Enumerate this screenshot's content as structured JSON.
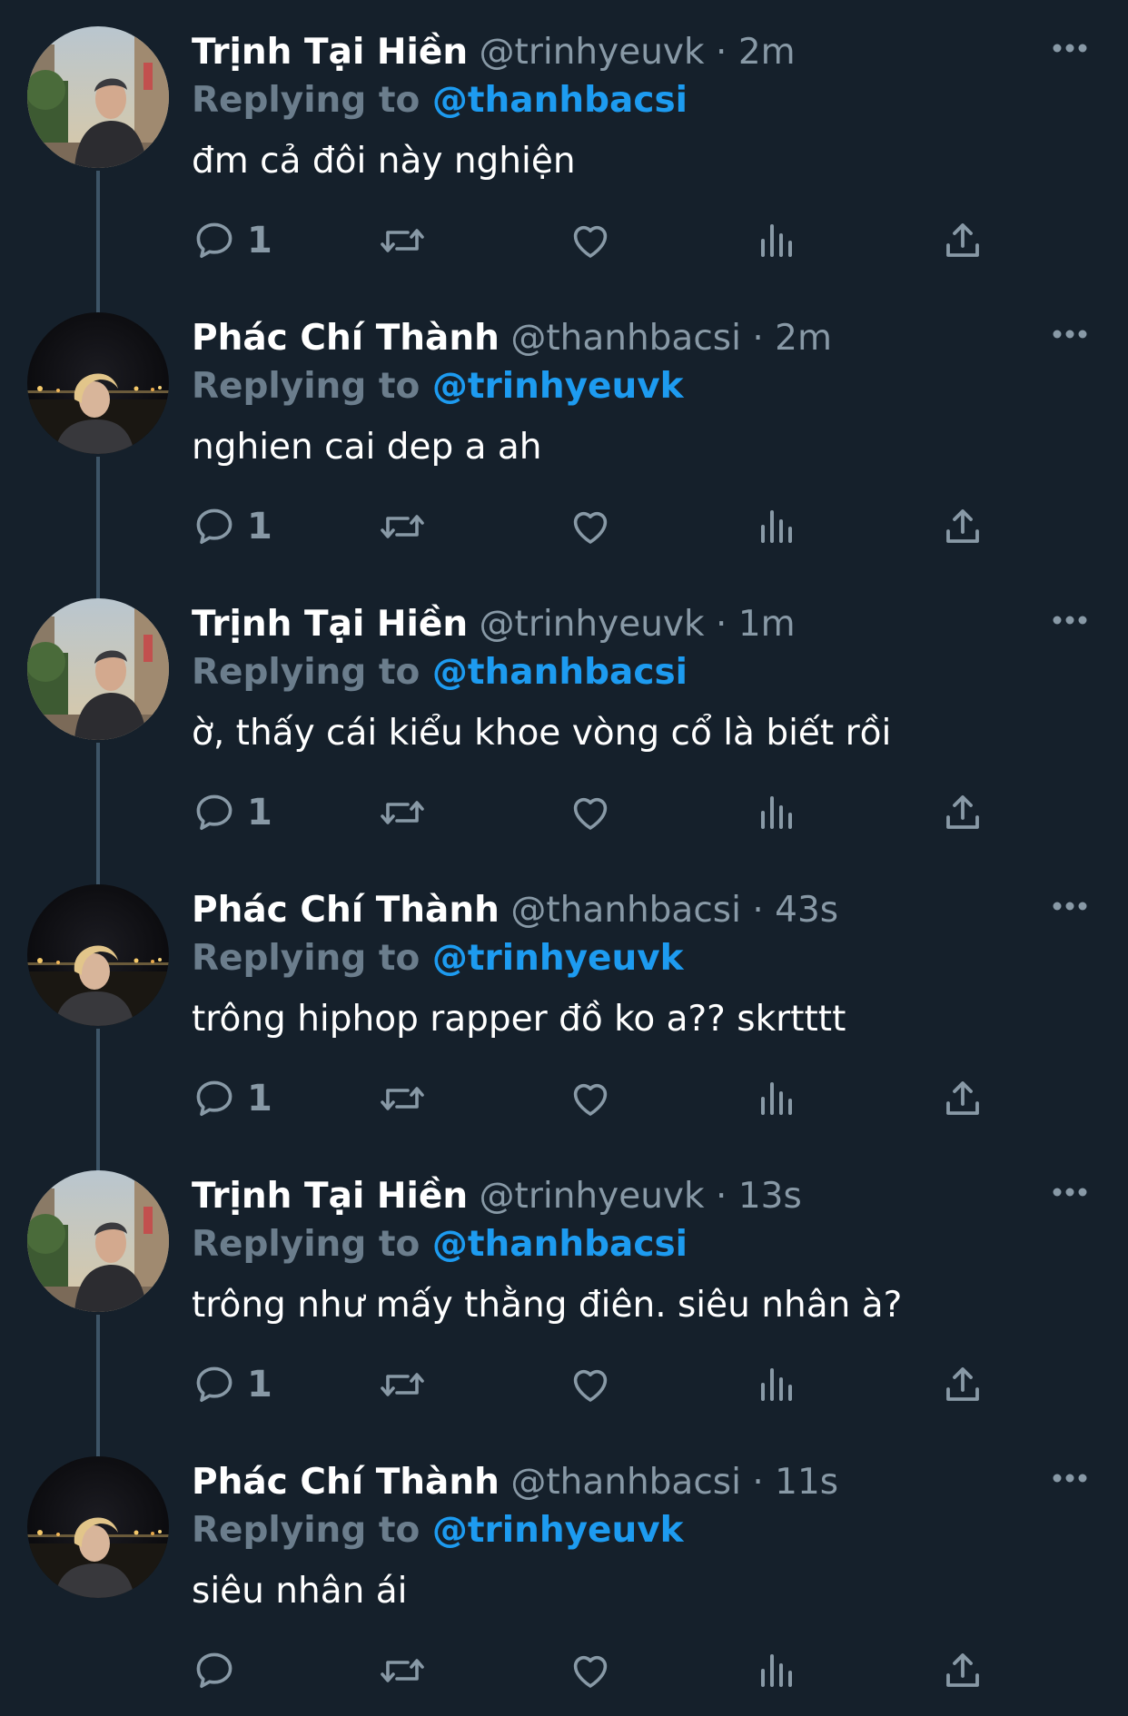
{
  "colors": {
    "background": "#15202b",
    "secondary_text": "#8899a6",
    "mention": "#1d9bf0",
    "thread_line": "#3d5466",
    "icon": "#8899a6"
  },
  "tweets": [
    {
      "name": "Trịnh Tại Hiền",
      "handle": "@trinhyeuvk",
      "separator": "·",
      "time": "2m",
      "reply_label": "Replying to",
      "reply_to": "@thanhbacsi",
      "text": "đm cả đôi này nghiện",
      "reply_count": "1",
      "avatar": "avatar-photo-man-street"
    },
    {
      "name": "Phác Chí Thành",
      "handle": "@thanhbacsi",
      "separator": "·",
      "time": "2m",
      "reply_label": "Replying to",
      "reply_to": "@trinhyeuvk",
      "text": "nghien cai dep a ah",
      "reply_count": "1",
      "avatar": "avatar-photo-blond-night"
    },
    {
      "name": "Trịnh Tại Hiền",
      "handle": "@trinhyeuvk",
      "separator": "·",
      "time": "1m",
      "reply_label": "Replying to",
      "reply_to": "@thanhbacsi",
      "text": "ờ, thấy cái kiểu khoe vòng cổ là biết rồi",
      "reply_count": "1",
      "avatar": "avatar-photo-man-street"
    },
    {
      "name": "Phác Chí Thành",
      "handle": "@thanhbacsi",
      "separator": "·",
      "time": "43s",
      "reply_label": "Replying to",
      "reply_to": "@trinhyeuvk",
      "text": "trông hiphop rapper đồ ko a?? skrtttt",
      "reply_count": "1",
      "avatar": "avatar-photo-blond-night"
    },
    {
      "name": "Trịnh Tại Hiền",
      "handle": "@trinhyeuvk",
      "separator": "·",
      "time": "13s",
      "reply_label": "Replying to",
      "reply_to": "@thanhbacsi",
      "text": "trông như mấy thằng điên. siêu nhân à?",
      "reply_count": "1",
      "avatar": "avatar-photo-man-street"
    },
    {
      "name": "Phác Chí Thành",
      "handle": "@thanhbacsi",
      "separator": "·",
      "time": "11s",
      "reply_label": "Replying to",
      "reply_to": "@trinhyeuvk",
      "text": "siêu nhân ái",
      "reply_count": "",
      "avatar": "avatar-photo-blond-night"
    }
  ]
}
